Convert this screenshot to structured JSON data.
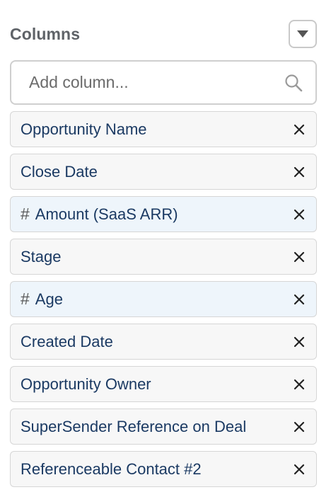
{
  "header": {
    "title": "Columns",
    "menu_icon": "triangle-down-icon"
  },
  "search": {
    "placeholder": "Add column...",
    "value": "",
    "icon": "search-icon"
  },
  "columns": [
    {
      "label": "Opportunity Name",
      "numeric": false
    },
    {
      "label": "Close Date",
      "numeric": false
    },
    {
      "label": "Amount (SaaS ARR)",
      "numeric": true,
      "prefix": "#"
    },
    {
      "label": "Stage",
      "numeric": false
    },
    {
      "label": "Age",
      "numeric": true,
      "prefix": "#"
    },
    {
      "label": "Created Date",
      "numeric": false
    },
    {
      "label": "Opportunity Owner",
      "numeric": false
    },
    {
      "label": "SuperSender Reference on Deal",
      "numeric": false
    },
    {
      "label": "Referenceable Contact #2",
      "numeric": false
    }
  ],
  "colors": {
    "title": "#5f6368",
    "label": "#1b3a63",
    "item_bg": "#f7f7f7",
    "numeric_item_bg": "#eef5fb"
  }
}
